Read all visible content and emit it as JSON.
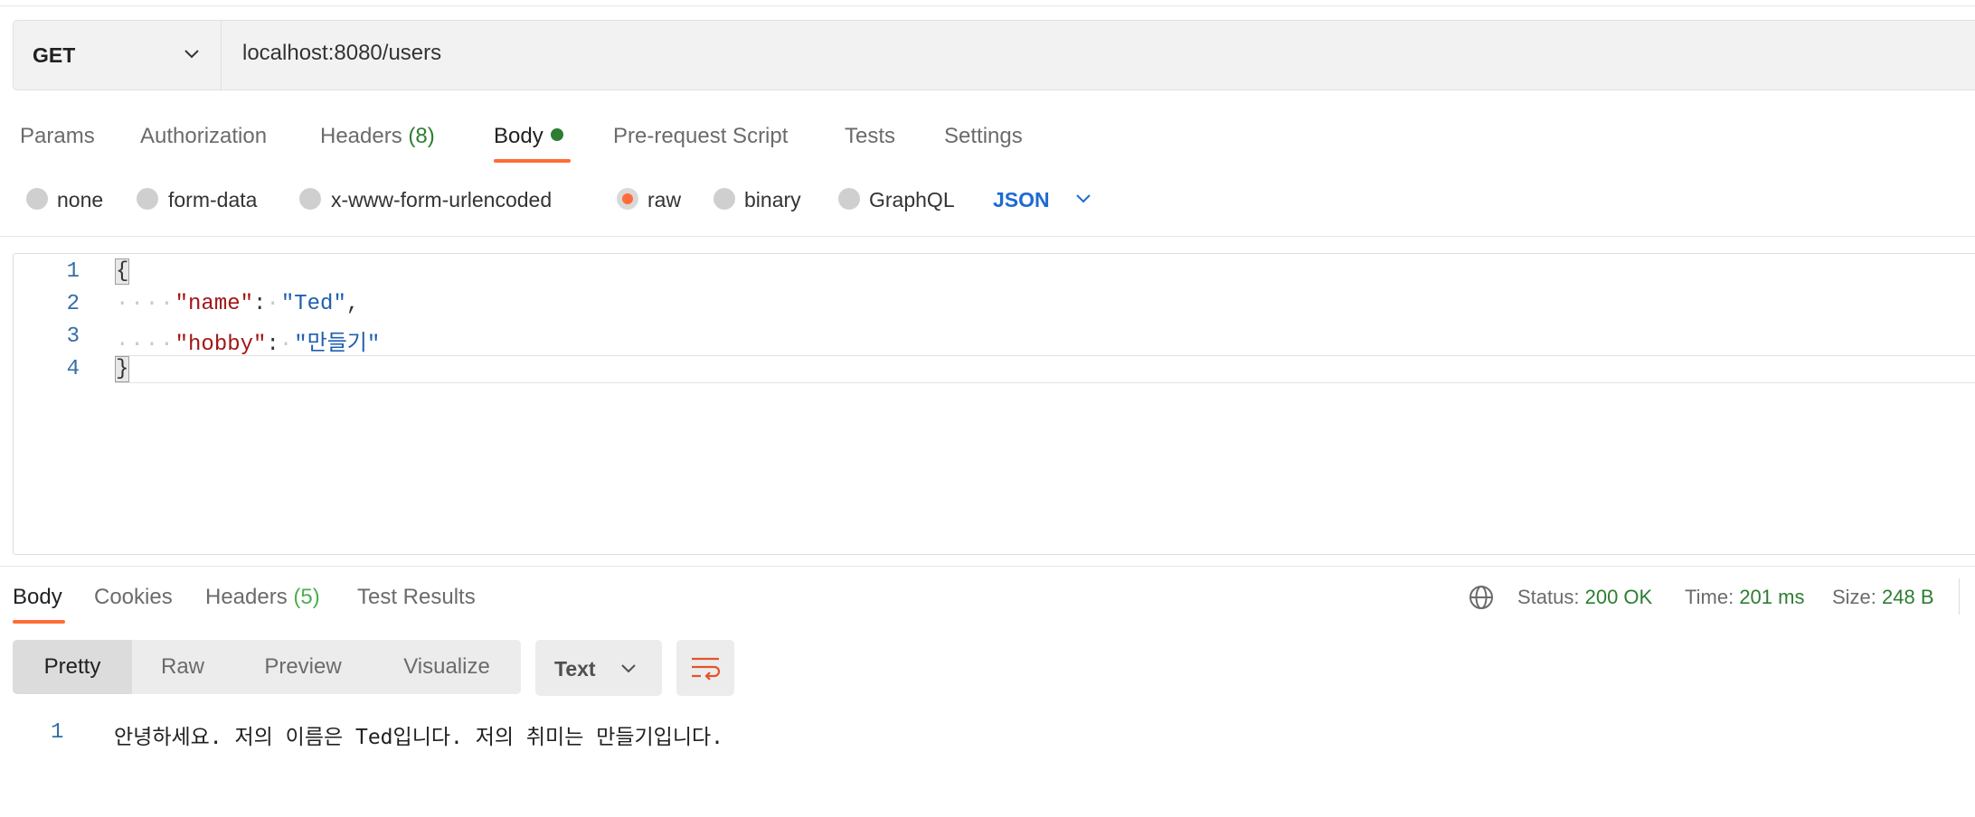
{
  "request": {
    "method": "GET",
    "url": "localhost:8080/users"
  },
  "request_tabs": [
    {
      "label": "Params"
    },
    {
      "label": "Authorization"
    },
    {
      "label": "Headers",
      "count": "(8)"
    },
    {
      "label": "Body",
      "active": true
    },
    {
      "label": "Pre-request Script"
    },
    {
      "label": "Tests"
    },
    {
      "label": "Settings"
    }
  ],
  "body_types": {
    "options": [
      "none",
      "form-data",
      "x-www-form-urlencoded",
      "raw",
      "binary",
      "GraphQL"
    ],
    "selected": "raw",
    "language": "JSON"
  },
  "editor": {
    "line_numbers": [
      "1",
      "2",
      "3",
      "4"
    ],
    "open_brace": "{",
    "close_brace": "}",
    "fields": [
      {
        "key": "\"name\"",
        "value": "\"Ted\"",
        "trailing": ","
      },
      {
        "key": "\"hobby\"",
        "value": "\"만들기\"",
        "trailing": ""
      }
    ]
  },
  "response": {
    "tabs": [
      {
        "label": "Body",
        "active": true
      },
      {
        "label": "Cookies"
      },
      {
        "label": "Headers",
        "count": "(5)"
      },
      {
        "label": "Test Results"
      }
    ],
    "status_label": "Status:",
    "status_value": "200 OK",
    "time_label": "Time:",
    "time_value": "201 ms",
    "size_label": "Size:",
    "size_value": "248 B",
    "view_modes": [
      "Pretty",
      "Raw",
      "Preview",
      "Visualize"
    ],
    "format": "Text",
    "lines": [
      {
        "number": "1",
        "text": "안녕하세요. 저의 이름은 Ted입니다. 저의 취미는 만들기입니다."
      }
    ]
  },
  "colors": {
    "accent": "#ff6c37",
    "success": "#2e7d32",
    "link": "#1d6ad2"
  }
}
